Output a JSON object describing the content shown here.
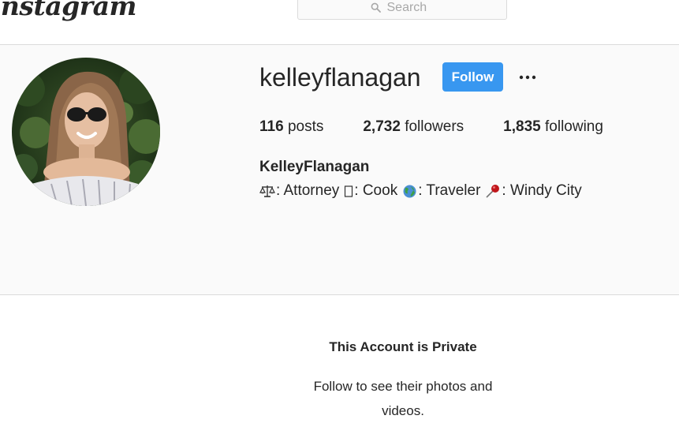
{
  "nav": {
    "logo_text": "Instagram",
    "search_placeholder": "Search",
    "search_icon": "search-icon"
  },
  "profile": {
    "username": "kelleyflanagan",
    "follow_label": "Follow",
    "more_icon": "more-options-icon",
    "stats": {
      "posts_count": "116",
      "posts_label": "posts",
      "followers_count": "2,732",
      "followers_label": "followers",
      "following_count": "1,835",
      "following_label": "following"
    },
    "full_name": "KelleyFlanagan",
    "bio": {
      "segments": [
        {
          "icon": "scales-icon",
          "text": ": Attorney"
        },
        {
          "icon": "missing-glyph-icon",
          "text": ": Cook"
        },
        {
          "icon": "globe-icon",
          "text": ": Traveler"
        },
        {
          "icon": "pushpin-icon",
          "text": ": Windy City"
        }
      ]
    }
  },
  "private_notice": {
    "title": "This Account is Private",
    "message": "Follow to see their photos and videos."
  },
  "colors": {
    "follow_button": "#3897f0",
    "background": "#fafafa",
    "border": "#dbdbdb",
    "text": "#262626"
  }
}
